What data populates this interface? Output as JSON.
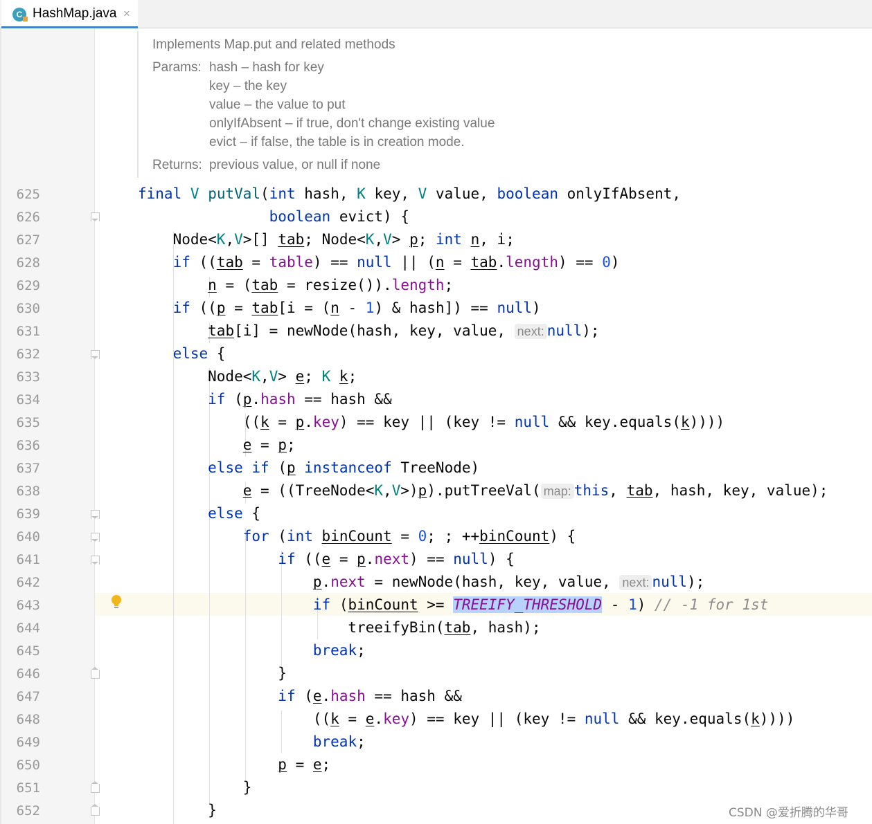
{
  "tab": {
    "title": "HashMap.java",
    "icon_letter": "C",
    "close": "×"
  },
  "doc": {
    "summary": "Implements Map.put and related methods",
    "params_label": "Params:",
    "params": [
      "hash – hash for key",
      "key – the key",
      "value – the value to put",
      "onlyIfAbsent – if true, don't change existing value",
      "evict – if false, the table is in creation mode."
    ],
    "returns_label": "Returns:",
    "returns": "previous value, or null if none"
  },
  "hints": {
    "next": "next:",
    "map": "map:"
  },
  "line_numbers": [
    "625",
    "626",
    "627",
    "628",
    "629",
    "630",
    "631",
    "632",
    "633",
    "634",
    "635",
    "636",
    "637",
    "638",
    "639",
    "640",
    "641",
    "642",
    "643",
    "644",
    "645",
    "646",
    "647",
    "648",
    "649",
    "650",
    "651",
    "652"
  ],
  "watermark": "CSDN @爱折腾的华哥",
  "colors": {
    "keyword": "#0033b3",
    "type_param": "#008080",
    "method_decl": "#00627a",
    "field": "#871094",
    "number": "#1750eb",
    "comment": "#8c8c8c",
    "selection": "#b7d2fb",
    "current_line": "#fcfaed",
    "tab_underline": "#4083c9"
  }
}
